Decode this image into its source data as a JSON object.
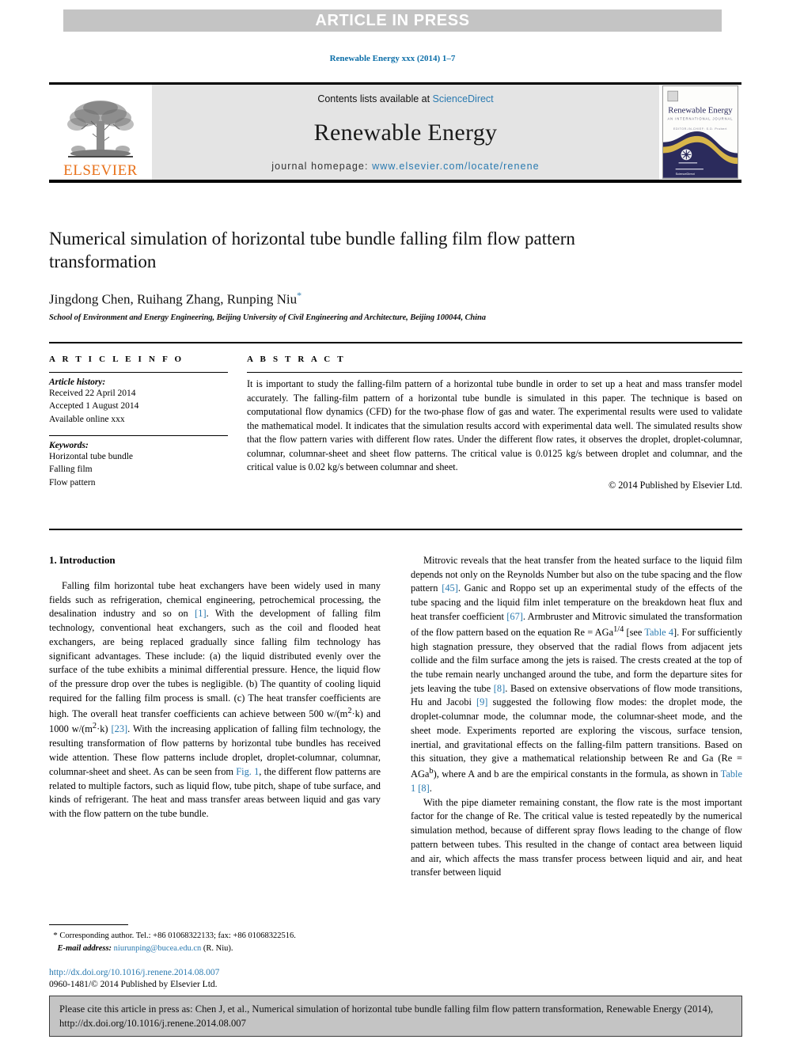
{
  "banner": {
    "label": "ARTICLE IN PRESS",
    "bg_color": "#c4c4c4",
    "text_color": "#ffffff"
  },
  "running_head": "Renewable Energy xxx (2014) 1–7",
  "masthead": {
    "contents_prefix": "Contents lists available at ",
    "contents_link": "ScienceDirect",
    "journal_title": "Renewable Energy",
    "homepage_prefix": "journal homepage: ",
    "homepage_url": "www.elsevier.com/locate/renene",
    "publisher_wordmark": "ELSEVIER",
    "publisher_color": "#E8711A",
    "link_color": "#2a7ab0",
    "cover": {
      "title": "Renewable Energy",
      "subtitle": "AN INTERNATIONAL JOURNAL",
      "editors": "EDITOR-IN-CHIEF: S.D. Probert",
      "footer": "ScienceDirect"
    }
  },
  "article": {
    "title": "Numerical simulation of horizontal tube bundle falling film flow pattern transformation",
    "authors": "Jingdong Chen, Ruihang Zhang, Runping Niu",
    "corresponding_marker": "*",
    "affiliation": "School of Environment and Energy Engineering, Beijing University of Civil Engineering and Architecture, Beijing 100044, China"
  },
  "info": {
    "heading": "A R T I C L E   I N F O",
    "history_label": "Article history:",
    "history": [
      "Received 22 April 2014",
      "Accepted 1 August 2014",
      "Available online xxx"
    ],
    "keywords_label": "Keywords:",
    "keywords": [
      "Horizontal tube bundle",
      "Falling film",
      "Flow pattern"
    ]
  },
  "abstract": {
    "heading": "A B S T R A C T",
    "text": "It is important to study the falling-film pattern of a horizontal tube bundle in order to set up a heat and mass transfer model accurately. The falling-film pattern of a horizontal tube bundle is simulated in this paper. The technique is based on computational flow dynamics (CFD) for the two-phase flow of gas and water. The experimental results were used to validate the mathematical model. It indicates that the simulation results accord with experimental data well. The simulated results show that the flow pattern varies with different flow rates. Under the different flow rates, it observes the droplet, droplet-columnar, columnar, columnar-sheet and sheet flow patterns. The critical value is 0.0125 kg/s between droplet and columnar, and the critical value is 0.02 kg/s between columnar and sheet.",
    "copyright": "© 2014 Published by Elsevier Ltd."
  },
  "body": {
    "section_number_title": "1.  Introduction",
    "left_para_1_a": "Falling film horizontal tube heat exchangers have been widely used in many fields such as refrigeration, chemical engineering, petrochemical processing, the desalination industry and so on ",
    "left_ref_1": "[1]",
    "left_para_1_b": ". With the development of falling film technology, conventional heat exchangers, such as the coil and flooded heat exchangers, are being replaced gradually since falling film technology has significant advantages. These include: (a) the liquid distributed evenly over the surface of the tube exhibits a minimal differential pressure. Hence, the liquid flow of the pressure drop over the tubes is negligible. (b) The quantity of cooling liquid required for the falling film process is small. (c) The heat transfer coefficients are high. The overall heat transfer coefficients can achieve between 500 w/(m",
    "left_sup_1": "2",
    "left_para_1_c": "·k) and 1000 w/(m",
    "left_sup_2": "2",
    "left_para_1_d": "·k) ",
    "left_ref_2": "[23]",
    "left_para_1_e": ". With the increasing application of falling film technology, the resulting transformation of flow patterns by horizontal tube bundles has received wide attention. These flow patterns include droplet, droplet-columnar, columnar, columnar-sheet and sheet. As can be seen from ",
    "left_ref_3": "Fig. 1",
    "left_para_1_f": ", the different flow patterns are related to multiple factors, such as liquid flow, tube pitch, shape of tube surface, and kinds of refrigerant. The heat and mass transfer areas between liquid and gas vary with the flow pattern on the tube bundle.",
    "right_para_1_a": "Mitrovic reveals that the heat transfer from the heated surface to the liquid film depends not only on the Reynolds Number but also on the tube spacing and the flow pattern ",
    "right_ref_1": "[45]",
    "right_para_1_b": ". Ganic and Roppo set up an experimental study of the effects of the tube spacing and the liquid film inlet temperature on the breakdown heat flux and heat transfer coefficient ",
    "right_ref_2": "[67]",
    "right_para_1_c": ". Armbruster and Mitrovic simulated the transformation of the flow pattern based on the equation Re = AGa",
    "right_sup_1": "1/4",
    "right_para_1_d": " [see ",
    "right_ref_3": "Table 4",
    "right_para_1_e": "]. For sufficiently high stagnation pressure, they observed that the radial flows from adjacent jets collide and the film surface among the jets is raised. The crests created at the top of the tube remain nearly unchanged around the tube, and form the departure sites for jets leaving the tube ",
    "right_ref_4": "[8]",
    "right_para_1_f": ". Based on extensive observations of flow mode transitions, Hu and Jacobi ",
    "right_ref_5": "[9]",
    "right_para_1_g": " suggested the following flow modes: the droplet mode, the droplet-columnar mode, the columnar mode, the columnar-sheet mode, and the sheet mode. Experiments reported are exploring the viscous, surface tension, inertial, and gravitational effects on the falling-film pattern transitions. Based on this situation, they give a mathematical relationship between Re and Ga (Re = AGa",
    "right_sup_2": "b",
    "right_para_1_h": "), where A and b are the empirical constants in the formula, as shown in ",
    "right_ref_6": "Table 1 [8]",
    "right_para_1_i": ".",
    "right_para_2": "With the pipe diameter remaining constant, the flow rate is the most important factor for the change of Re. The critical value is tested repeatedly by the numerical simulation method, because of different spray flows leading to the change of flow pattern between tubes. This resulted in the change of contact area between liquid and air, which affects the mass transfer process between liquid and air, and heat transfer between liquid"
  },
  "footnote": {
    "marker": "*",
    "line1": "Corresponding author. Tel.: +86 01068322133; fax: +86 01068322516.",
    "email_label": "E-mail address:",
    "email": "niurunping@bucea.edu.cn",
    "email_suffix": "(R. Niu)."
  },
  "doi_block": {
    "doi": "http://dx.doi.org/10.1016/j.renene.2014.08.007",
    "issn_copyright": "0960-1481/© 2014 Published by Elsevier Ltd."
  },
  "citation_footer": {
    "text": "Please cite this article in press as: Chen J, et al., Numerical simulation of horizontal tube bundle falling film flow pattern transformation, Renewable Energy (2014), http://dx.doi.org/10.1016/j.renene.2014.08.007"
  }
}
